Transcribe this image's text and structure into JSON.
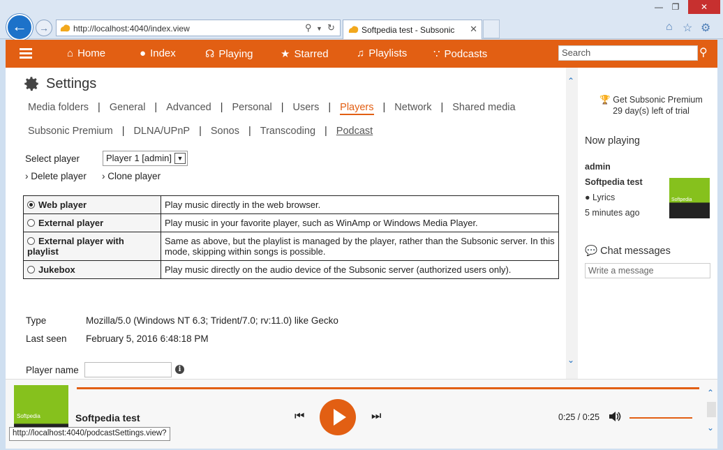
{
  "browser": {
    "url": "http://localhost:4040/index.view",
    "tab_title": "Softpedia test - Subsonic",
    "status_url": "http://localhost:4040/podcastSettings.view?"
  },
  "header": {
    "nav": [
      {
        "label": "Home",
        "icon": "home-icon"
      },
      {
        "label": "Index",
        "icon": "microphone-icon"
      },
      {
        "label": "Playing",
        "icon": "headphones-icon"
      },
      {
        "label": "Starred",
        "icon": "star-icon"
      },
      {
        "label": "Playlists",
        "icon": "music-note-icon"
      },
      {
        "label": "Podcasts",
        "icon": "rss-icon"
      }
    ],
    "search_placeholder": "Search"
  },
  "settings": {
    "title": "Settings",
    "tabs_row1": [
      "Media folders",
      "General",
      "Advanced",
      "Personal",
      "Users",
      "Players",
      "Network",
      "Shared media"
    ],
    "tabs_row2": [
      "Subsonic Premium",
      "DLNA/UPnP",
      "Sonos",
      "Transcoding",
      "Podcast"
    ],
    "active_tab": "Players",
    "select_player_label": "Select player",
    "selected_player": "Player 1 [admin]",
    "delete_player": "Delete player",
    "clone_player": "Clone player",
    "player_types": [
      {
        "name": "Web player",
        "desc": "Play music directly in the web browser.",
        "selected": true
      },
      {
        "name": "External player",
        "desc": "Play music in your favorite player, such as WinAmp or Windows Media Player.",
        "selected": false
      },
      {
        "name": "External player with playlist",
        "desc": "Same as above, but the playlist is managed by the player, rather than the Subsonic server. In this mode, skipping within songs is possible.",
        "selected": false
      },
      {
        "name": "Jukebox",
        "desc": "Play music directly on the audio device of the Subsonic server (authorized users only).",
        "selected": false
      }
    ],
    "type_label": "Type",
    "type_value": "Mozilla/5.0 (Windows NT 6.3; Trident/7.0; rv:11.0) like Gecko",
    "last_seen_label": "Last seen",
    "last_seen_value": "February 5, 2016 6:48:18 PM",
    "player_name_label": "Player name"
  },
  "right_panel": {
    "premium_line1": "Get Subsonic Premium",
    "premium_line2": "29 day(s) left of trial",
    "now_playing_title": "Now playing",
    "user": "admin",
    "song": "Softpedia test",
    "lyrics": "Lyrics",
    "time_ago": "5 minutes ago",
    "cover_text": "Softpedia",
    "chat_title": "Chat messages",
    "chat_placeholder": "Write a message"
  },
  "player": {
    "title": "Softpedia test",
    "cover_text": "Softpedia",
    "time": "0:25 / 0:25",
    "progress": 1.0,
    "volume": 0.92
  },
  "colors": {
    "accent": "#e25f13",
    "link_blue": "#1d6fc1"
  }
}
